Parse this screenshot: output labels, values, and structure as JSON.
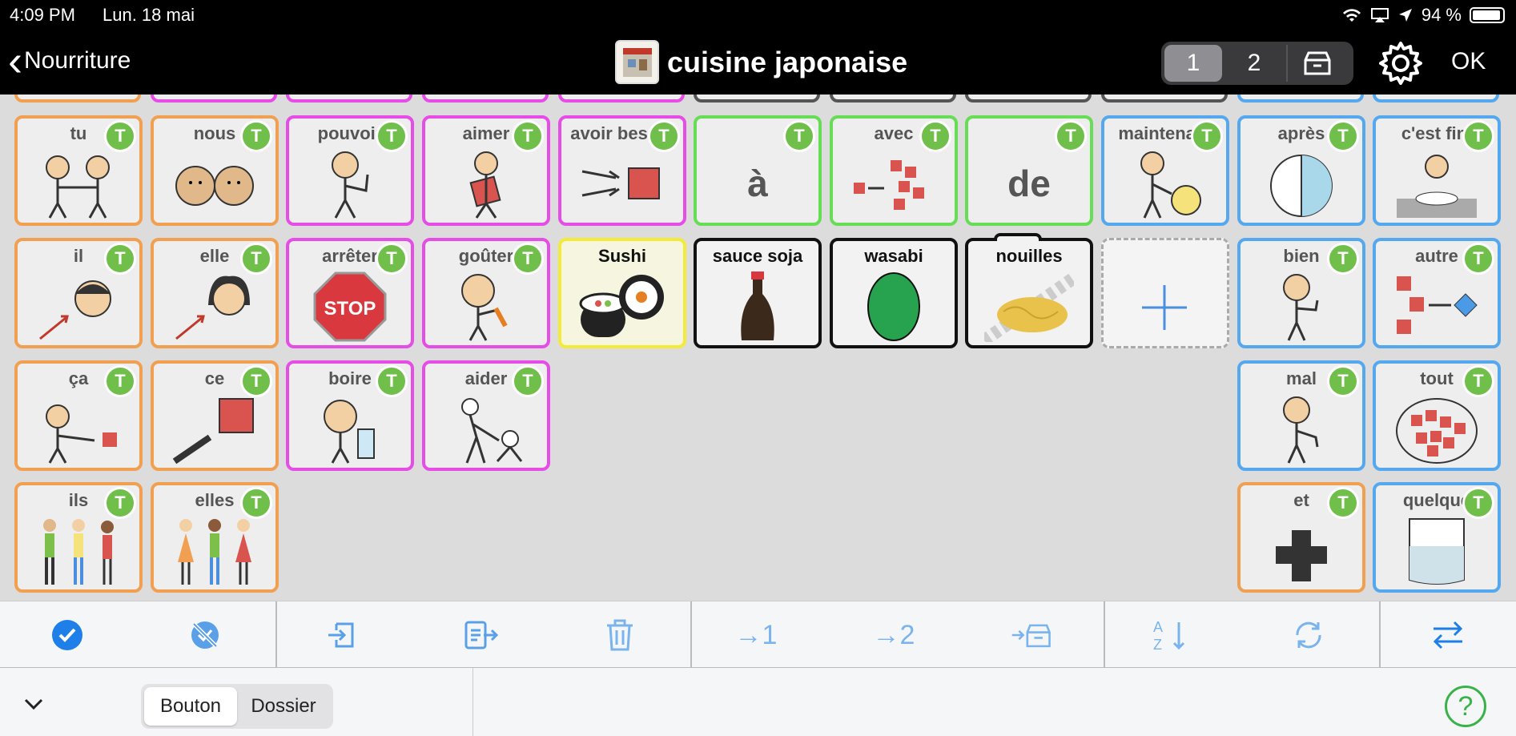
{
  "status": {
    "time": "4:09 PM",
    "date": "Lun. 18 mai",
    "battery": "94 %"
  },
  "nav": {
    "back_label": "Nourriture",
    "title": "cuisine japonaise",
    "pages": [
      "1",
      "2"
    ],
    "active_page": "1",
    "ok_label": "OK"
  },
  "colors": {
    "orange": "#f0a050",
    "pink": "#e64ce6",
    "green": "#66dd55",
    "blue": "#55a8ee",
    "badge": "#6fbf4a",
    "accent": "#5aa0e8"
  },
  "tiles": {
    "tu": "tu",
    "nous": "nous",
    "pouvoir": "pouvoir",
    "aimer": "aimer",
    "avoir_besoin": "avoir besoin",
    "a": "à",
    "avec": "avec",
    "de": "de",
    "maintenant": "maintenant",
    "apres": "après",
    "cest_fini": "c'est fini",
    "il": "il",
    "elle": "elle",
    "arreter": "arrêter",
    "gouter": "goûter",
    "sushi": "Sushi",
    "sauce_soja": "sauce soja",
    "wasabi": "wasabi",
    "nouilles": "nouilles",
    "bien": "bien",
    "autre": "autre",
    "ca": "ça",
    "ce": "ce",
    "boire": "boire",
    "aider": "aider",
    "mal": "mal",
    "tout": "tout",
    "ils": "ils",
    "elles": "elles",
    "et": "et",
    "quelque": "quelque",
    "badge": "T",
    "stop_text": "STOP"
  },
  "toolbar": {
    "to_page_1": "→1",
    "to_page_2": "→2"
  },
  "bottom": {
    "mode_button": "Bouton",
    "mode_folder": "Dossier",
    "help": "?"
  }
}
